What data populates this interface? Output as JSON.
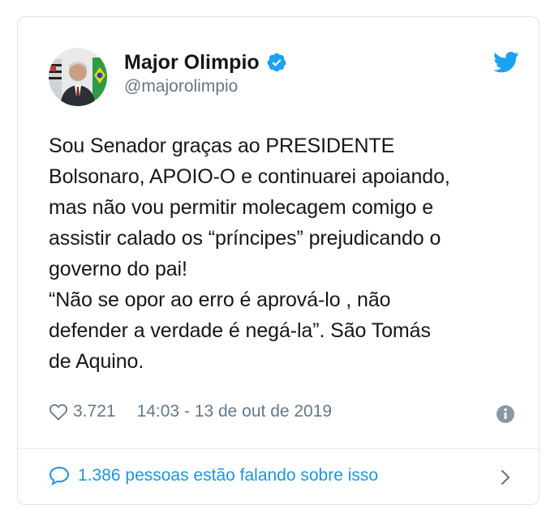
{
  "tweet": {
    "author_name": "Major Olimpio",
    "handle": "@majorolimpio",
    "text": "Sou Senador graças ao PRESIDENTE\nBolsonaro, APOIO-O e continuarei apoiando,\nmas não vou permitir molecagem comigo e\nassistir calado os “príncipes” prejudicando o\ngoverno do pai!\n“Não se opor ao erro é aprová-lo , não\ndefender a verdade é negá-la”. São Tomás\nde Aquino.",
    "likes": "3.721",
    "timestamp": "14:03 - 13 de out de 2019",
    "conversation": "1.386 pessoas estão falando sobre isso"
  },
  "icons": {
    "verified": "verified-badge-icon",
    "brand": "twitter-bird-icon",
    "like": "heart-icon",
    "info": "info-icon",
    "reply": "speech-bubble-icon",
    "more": "chevron-right-icon"
  },
  "colors": {
    "primary_text": "#14171a",
    "secondary_text": "#657786",
    "accent": "#1da1f2",
    "link": "#1b95e0"
  }
}
